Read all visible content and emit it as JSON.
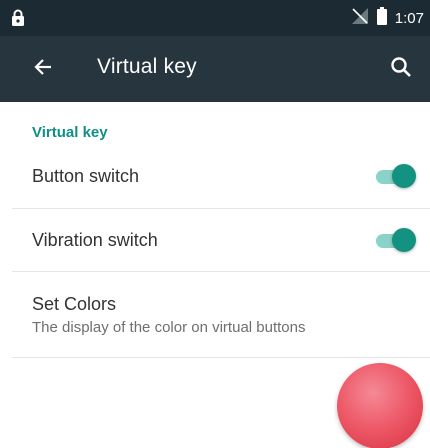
{
  "status_bar": {
    "time": "1:07",
    "icons": [
      "lock-icon",
      "no-signal-icon",
      "battery-icon"
    ]
  },
  "app_bar": {
    "title": "Virtual key",
    "back_icon": "arrow-left-icon",
    "search_icon": "search-icon"
  },
  "preferences": {
    "category": "Virtual key",
    "button_switch": {
      "label": "Button switch",
      "checked": true
    },
    "vibration_switch": {
      "label": "Vibration switch",
      "checked": true
    },
    "set_colors": {
      "label": "Set Colors",
      "summary": "The display of the color on virtual buttons"
    }
  },
  "colors": {
    "status_bar": "#1c2b33",
    "app_bar": "#26353e",
    "accent": "#139181",
    "category_text": "#0f8f86",
    "virtual_button": "#ee5b6a"
  }
}
